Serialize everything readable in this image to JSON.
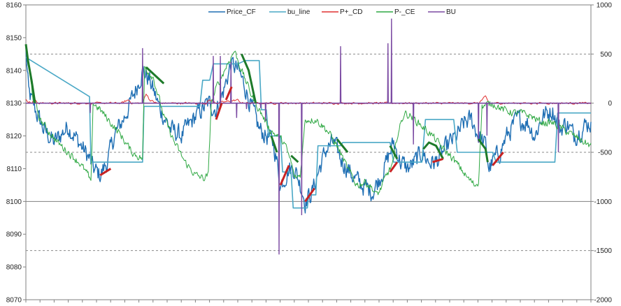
{
  "chart_data": {
    "type": "line",
    "title": "",
    "xlabel": "",
    "ylabel": "",
    "grid": true,
    "legend_position": "top",
    "ylim_left": [
      8070,
      8160
    ],
    "yticks_left": [
      "8160",
      "8150",
      "8140",
      "8130",
      "8120",
      "8110",
      "8100",
      "8090",
      "8080",
      "8070"
    ],
    "ylim_right": [
      -2000,
      1000
    ],
    "yticks_right": [
      "1000",
      "500",
      "0",
      "-500",
      "-1000",
      "-1500",
      "-2000"
    ],
    "dashed_gridlines_right": [
      500,
      -500,
      -1500
    ],
    "x_count": 800,
    "series": [
      {
        "name": "Price_CF",
        "color": "#1f6fb4",
        "axis": "left",
        "anchors": [
          [
            0,
            8146
          ],
          [
            4,
            8133
          ],
          [
            15,
            8127
          ],
          [
            25,
            8122
          ],
          [
            40,
            8118
          ],
          [
            60,
            8123
          ],
          [
            75,
            8118
          ],
          [
            90,
            8113
          ],
          [
            95,
            8110
          ],
          [
            105,
            8108
          ],
          [
            115,
            8112
          ],
          [
            125,
            8120
          ],
          [
            140,
            8126
          ],
          [
            155,
            8134
          ],
          [
            165,
            8140
          ],
          [
            175,
            8137
          ],
          [
            190,
            8128
          ],
          [
            205,
            8122
          ],
          [
            220,
            8120
          ],
          [
            240,
            8126
          ],
          [
            258,
            8130
          ],
          [
            270,
            8128
          ],
          [
            280,
            8134
          ],
          [
            290,
            8142
          ],
          [
            300,
            8140
          ],
          [
            310,
            8135
          ],
          [
            320,
            8128
          ],
          [
            330,
            8122
          ],
          [
            340,
            8120
          ],
          [
            350,
            8118
          ],
          [
            355,
            8112
          ],
          [
            360,
            8105
          ],
          [
            372,
            8110
          ],
          [
            380,
            8110
          ],
          [
            390,
            8104
          ],
          [
            395,
            8100
          ],
          [
            405,
            8103
          ],
          [
            415,
            8110
          ],
          [
            425,
            8116
          ],
          [
            435,
            8118
          ],
          [
            445,
            8113
          ],
          [
            455,
            8110
          ],
          [
            465,
            8107
          ],
          [
            475,
            8105
          ],
          [
            490,
            8103
          ],
          [
            500,
            8107
          ],
          [
            510,
            8112
          ],
          [
            520,
            8118
          ],
          [
            530,
            8112
          ],
          [
            540,
            8110
          ],
          [
            550,
            8112
          ],
          [
            560,
            8115
          ],
          [
            570,
            8112
          ],
          [
            580,
            8112
          ],
          [
            590,
            8115
          ],
          [
            600,
            8118
          ],
          [
            610,
            8120
          ],
          [
            620,
            8124
          ],
          [
            630,
            8125
          ],
          [
            640,
            8120
          ],
          [
            650,
            8117
          ],
          [
            655,
            8110
          ],
          [
            660,
            8112
          ],
          [
            670,
            8115
          ],
          [
            680,
            8120
          ],
          [
            695,
            8125
          ],
          [
            710,
            8124
          ],
          [
            720,
            8120
          ],
          [
            730,
            8126
          ],
          [
            745,
            8128
          ],
          [
            755,
            8122
          ],
          [
            765,
            8124
          ],
          [
            775,
            8120
          ],
          [
            785,
            8122
          ],
          [
            795,
            8124
          ],
          [
            799,
            8124
          ]
        ]
      },
      {
        "name": "bu_line",
        "color": "#4aa8c6",
        "axis": "left",
        "steps": [
          [
            0,
            8144
          ],
          [
            90,
            8132
          ],
          [
            92,
            8112
          ],
          [
            165,
            8112
          ],
          [
            167,
            8129
          ],
          [
            246,
            8129
          ],
          [
            250,
            8137
          ],
          [
            260,
            8137
          ],
          [
            265,
            8142
          ],
          [
            300,
            8142
          ],
          [
            310,
            8143
          ],
          [
            330,
            8143
          ],
          [
            333,
            8128
          ],
          [
            340,
            8128
          ],
          [
            343,
            8120
          ],
          [
            360,
            8120
          ],
          [
            363,
            8109
          ],
          [
            375,
            8109
          ],
          [
            378,
            8098
          ],
          [
            398,
            8098
          ],
          [
            400,
            8102
          ],
          [
            410,
            8102
          ],
          [
            413,
            8117
          ],
          [
            445,
            8117
          ],
          [
            448,
            8118
          ],
          [
            515,
            8118
          ],
          [
            520,
            8112
          ],
          [
            560,
            8112
          ],
          [
            565,
            8125
          ],
          [
            605,
            8125
          ],
          [
            610,
            8115
          ],
          [
            660,
            8115
          ],
          [
            665,
            8112
          ],
          [
            748,
            8112
          ],
          [
            752,
            8127
          ],
          [
            799,
            8127
          ]
        ]
      },
      {
        "name": "P+_CD",
        "color": "#e03030",
        "axis": "left",
        "anchors": [
          [
            0,
            8131
          ],
          [
            8,
            8130
          ],
          [
            13,
            8131
          ],
          [
            18,
            8130
          ],
          [
            35,
            8130
          ],
          [
            55,
            8130
          ],
          [
            80,
            8130
          ],
          [
            100,
            8130
          ],
          [
            135,
            8130
          ],
          [
            145,
            8131
          ],
          [
            150,
            8130
          ],
          [
            165,
            8130
          ],
          [
            170,
            8133
          ],
          [
            175,
            8131
          ],
          [
            185,
            8130
          ],
          [
            230,
            8130
          ],
          [
            255,
            8130
          ],
          [
            260,
            8131
          ],
          [
            270,
            8130
          ],
          [
            300,
            8131
          ],
          [
            305,
            8130
          ],
          [
            330,
            8130
          ],
          [
            345,
            8130
          ],
          [
            400,
            8130
          ],
          [
            500,
            8130
          ],
          [
            560,
            8130
          ],
          [
            640,
            8130
          ],
          [
            650,
            8132
          ],
          [
            655,
            8130
          ],
          [
            720,
            8130
          ],
          [
            799,
            8130
          ]
        ]
      },
      {
        "name": "P-_CE",
        "color": "#2fa843",
        "axis": "left",
        "anchors": [
          [
            0,
            8146
          ],
          [
            10,
            8132
          ],
          [
            20,
            8125
          ],
          [
            30,
            8122
          ],
          [
            45,
            8118
          ],
          [
            60,
            8115
          ],
          [
            75,
            8112
          ],
          [
            88,
            8108
          ],
          [
            92,
            8105
          ],
          [
            95,
            8130
          ],
          [
            105,
            8128
          ],
          [
            120,
            8124
          ],
          [
            135,
            8120
          ],
          [
            150,
            8115
          ],
          [
            165,
            8113
          ],
          [
            168,
            8141
          ],
          [
            180,
            8138
          ],
          [
            195,
            8126
          ],
          [
            210,
            8118
          ],
          [
            225,
            8112
          ],
          [
            240,
            8108
          ],
          [
            252,
            8107
          ],
          [
            258,
            8108
          ],
          [
            262,
            8130
          ],
          [
            270,
            8135
          ],
          [
            285,
            8142
          ],
          [
            295,
            8146
          ],
          [
            305,
            8140
          ],
          [
            320,
            8132
          ],
          [
            335,
            8126
          ],
          [
            345,
            8122
          ],
          [
            355,
            8120
          ],
          [
            365,
            8118
          ],
          [
            375,
            8112
          ],
          [
            380,
            8107
          ],
          [
            388,
            8108
          ],
          [
            395,
            8125
          ],
          [
            410,
            8125
          ],
          [
            425,
            8122
          ],
          [
            440,
            8117
          ],
          [
            455,
            8110
          ],
          [
            465,
            8106
          ],
          [
            470,
            8105
          ],
          [
            480,
            8106
          ],
          [
            490,
            8104
          ],
          [
            495,
            8102
          ],
          [
            500,
            8103
          ],
          [
            510,
            8108
          ],
          [
            520,
            8112
          ],
          [
            525,
            8120
          ],
          [
            535,
            8127
          ],
          [
            545,
            8126
          ],
          [
            555,
            8124
          ],
          [
            565,
            8122
          ],
          [
            575,
            8120
          ],
          [
            590,
            8116
          ],
          [
            600,
            8114
          ],
          [
            615,
            8110
          ],
          [
            625,
            8107
          ],
          [
            635,
            8105
          ],
          [
            640,
            8106
          ],
          [
            645,
            8129
          ],
          [
            660,
            8130
          ],
          [
            675,
            8128
          ],
          [
            690,
            8127
          ],
          [
            700,
            8127
          ],
          [
            715,
            8126
          ],
          [
            730,
            8124
          ],
          [
            745,
            8124
          ],
          [
            760,
            8122
          ],
          [
            775,
            8120
          ],
          [
            790,
            8118
          ],
          [
            799,
            8117
          ]
        ]
      },
      {
        "name": "BU",
        "color": "#7b4aa2",
        "axis": "right",
        "baseline": 0,
        "spikes": [
          [
            91,
            -100
          ],
          [
            165,
            560
          ],
          [
            265,
            480
          ],
          [
            275,
            480
          ],
          [
            290,
            420
          ],
          [
            298,
            -150
          ],
          [
            312,
            -60
          ],
          [
            332,
            -50
          ],
          [
            339,
            -180
          ],
          [
            358,
            -1540
          ],
          [
            390,
            -1140
          ],
          [
            445,
            580
          ],
          [
            512,
            610
          ],
          [
            517,
            860
          ],
          [
            548,
            -420
          ],
          [
            640,
            -400
          ],
          [
            652,
            -330
          ],
          [
            753,
            -500
          ]
        ]
      }
    ],
    "highlight_segments": [
      {
        "color": "#1e7a2a",
        "points": [
          [
            0,
            8148
          ],
          [
            3,
            8143
          ],
          [
            8,
            8137
          ],
          [
            13,
            8130
          ]
        ]
      },
      {
        "color": "#1e7a2a",
        "points": [
          [
            170,
            8141
          ],
          [
            185,
            8138
          ],
          [
            195,
            8136
          ]
        ]
      },
      {
        "color": "#1e7a2a",
        "points": [
          [
            305,
            8145
          ],
          [
            315,
            8140
          ],
          [
            320,
            8135
          ],
          [
            325,
            8130
          ]
        ]
      },
      {
        "color": "#1e7a2a",
        "points": [
          [
            347,
            8120
          ],
          [
            355,
            8115
          ]
        ]
      },
      {
        "color": "#1e7a2a",
        "points": [
          [
            375,
            8114
          ],
          [
            385,
            8112
          ]
        ]
      },
      {
        "color": "#1e7a2a",
        "points": [
          [
            440,
            8119
          ],
          [
            455,
            8115
          ]
        ]
      },
      {
        "color": "#1e7a2a",
        "points": [
          [
            515,
            8117
          ],
          [
            525,
            8113
          ]
        ]
      },
      {
        "color": "#1e7a2a",
        "points": [
          [
            562,
            8116
          ],
          [
            570,
            8118
          ],
          [
            580,
            8117
          ],
          [
            590,
            8113
          ]
        ]
      },
      {
        "color": "#1e7a2a",
        "points": [
          [
            640,
            8119
          ],
          [
            650,
            8116
          ],
          [
            653,
            8112
          ]
        ]
      },
      {
        "color": "#c72222",
        "points": [
          [
            105,
            8108
          ],
          [
            120,
            8110
          ]
        ]
      },
      {
        "color": "#c72222",
        "points": [
          [
            269,
            8125
          ],
          [
            277,
            8130
          ]
        ]
      },
      {
        "color": "#c72222",
        "points": [
          [
            283,
            8131
          ],
          [
            291,
            8135
          ]
        ]
      },
      {
        "color": "#c72222",
        "points": [
          [
            360,
            8105
          ],
          [
            372,
            8111
          ]
        ]
      },
      {
        "color": "#c72222",
        "points": [
          [
            395,
            8100
          ],
          [
            408,
            8104
          ]
        ]
      },
      {
        "color": "#c72222",
        "points": [
          [
            515,
            8109
          ],
          [
            525,
            8112
          ]
        ]
      },
      {
        "color": "#c72222",
        "points": [
          [
            575,
            8112
          ],
          [
            590,
            8113
          ]
        ]
      },
      {
        "color": "#c72222",
        "points": [
          [
            660,
            8111
          ],
          [
            675,
            8115
          ]
        ]
      }
    ]
  }
}
